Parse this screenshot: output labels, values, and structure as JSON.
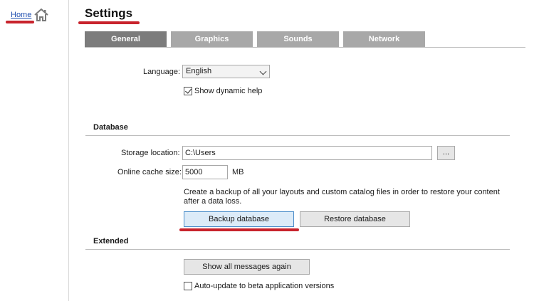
{
  "sidebar": {
    "home_label": "Home"
  },
  "page": {
    "title": "Settings"
  },
  "tabs": [
    {
      "label": "General",
      "active": true
    },
    {
      "label": "Graphics",
      "active": false
    },
    {
      "label": "Sounds",
      "active": false
    },
    {
      "label": "Network",
      "active": false
    }
  ],
  "general": {
    "language_label": "Language:",
    "language_value": "English",
    "dynamic_help_label": "Show dynamic help",
    "dynamic_help_checked": true
  },
  "database": {
    "section_title": "Database",
    "storage_label": "Storage location:",
    "storage_value": "C:\\Users",
    "browse_label": "...",
    "cache_label": "Online cache size:",
    "cache_value": "5000",
    "cache_unit": "MB",
    "help_text": "Create a backup of all your layouts and custom catalog files in order to restore your content after a data loss.",
    "backup_label": "Backup database",
    "restore_label": "Restore database"
  },
  "extended": {
    "section_title": "Extended",
    "show_messages_label": "Show all messages again",
    "auto_update_label": "Auto-update to beta application versions",
    "auto_update_checked": false
  },
  "colors": {
    "accent_underline": "#c8232c",
    "active_tab": "#7c7c7c",
    "inactive_tab": "#a8a8a8",
    "primary_border": "#4a8cc9"
  }
}
